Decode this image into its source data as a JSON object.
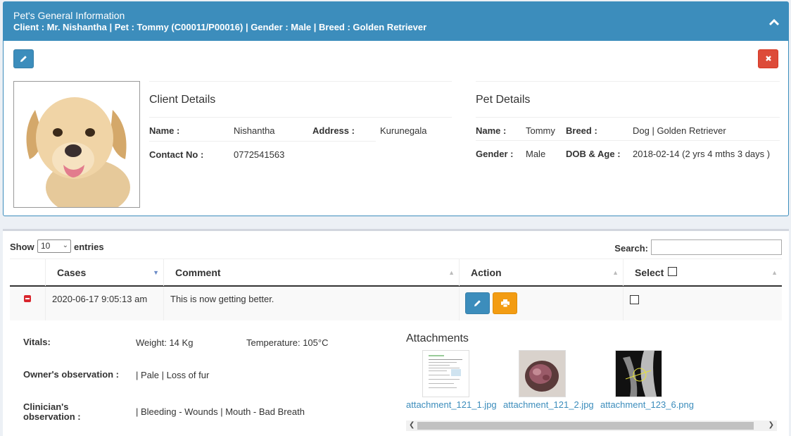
{
  "header": {
    "title": "Pet's General Information",
    "subtitle": "Client : Mr. Nishantha | Pet : Tommy (C00011/P00016) | Gender : Male | Breed : Golden Retriever"
  },
  "client": {
    "section_title": "Client Details",
    "name_label": "Name :",
    "name": "Nishantha",
    "address_label": "Address :",
    "address": "Kurunegala",
    "contact_label": "Contact No :",
    "contact": "0772541563"
  },
  "pet": {
    "section_title": "Pet Details",
    "name_label": "Name :",
    "name": "Tommy",
    "breed_label": "Breed :",
    "breed": "Dog | Golden Retriever",
    "gender_label": "Gender :",
    "gender": "Male",
    "dob_label": "DOB & Age :",
    "dob": "2018-02-14 (2 yrs 4 mths 3 days )"
  },
  "table": {
    "show_label": "Show",
    "page_length": "10",
    "entries_label": "entries",
    "search_label": "Search:",
    "columns": [
      "Cases",
      "Comment",
      "Action",
      "Select"
    ],
    "rows": [
      {
        "date": "2020-06-17 9:05:13 am",
        "comment": "This is now getting better."
      }
    ]
  },
  "detail": {
    "vitals_label": "Vitals:",
    "weight": "Weight: 14 Kg",
    "temperature": "Temperature: 105°C",
    "owner_label": "Owner's observation :",
    "owner_value": "| Pale | Loss of fur",
    "clinician_label_1": "Clinician's",
    "clinician_label_2": "observation :",
    "clinician_value": "| Bleeding - Wounds | Mouth - Bad Breath",
    "attachments_title": "Attachments",
    "attachments": [
      "attachment_121_1.jpg",
      "attachment_121_2.jpg",
      "attachment_123_6.png"
    ]
  },
  "icons": [
    "chevron-up-icon",
    "pencil-icon",
    "close-icon",
    "print-icon",
    "minus-icon",
    "sort-icon",
    "caret-down-icon"
  ],
  "colors": {
    "primary": "#3c8dbc",
    "danger": "#dd4b39",
    "warning": "#f39c12",
    "background": "#ecf0f5"
  }
}
